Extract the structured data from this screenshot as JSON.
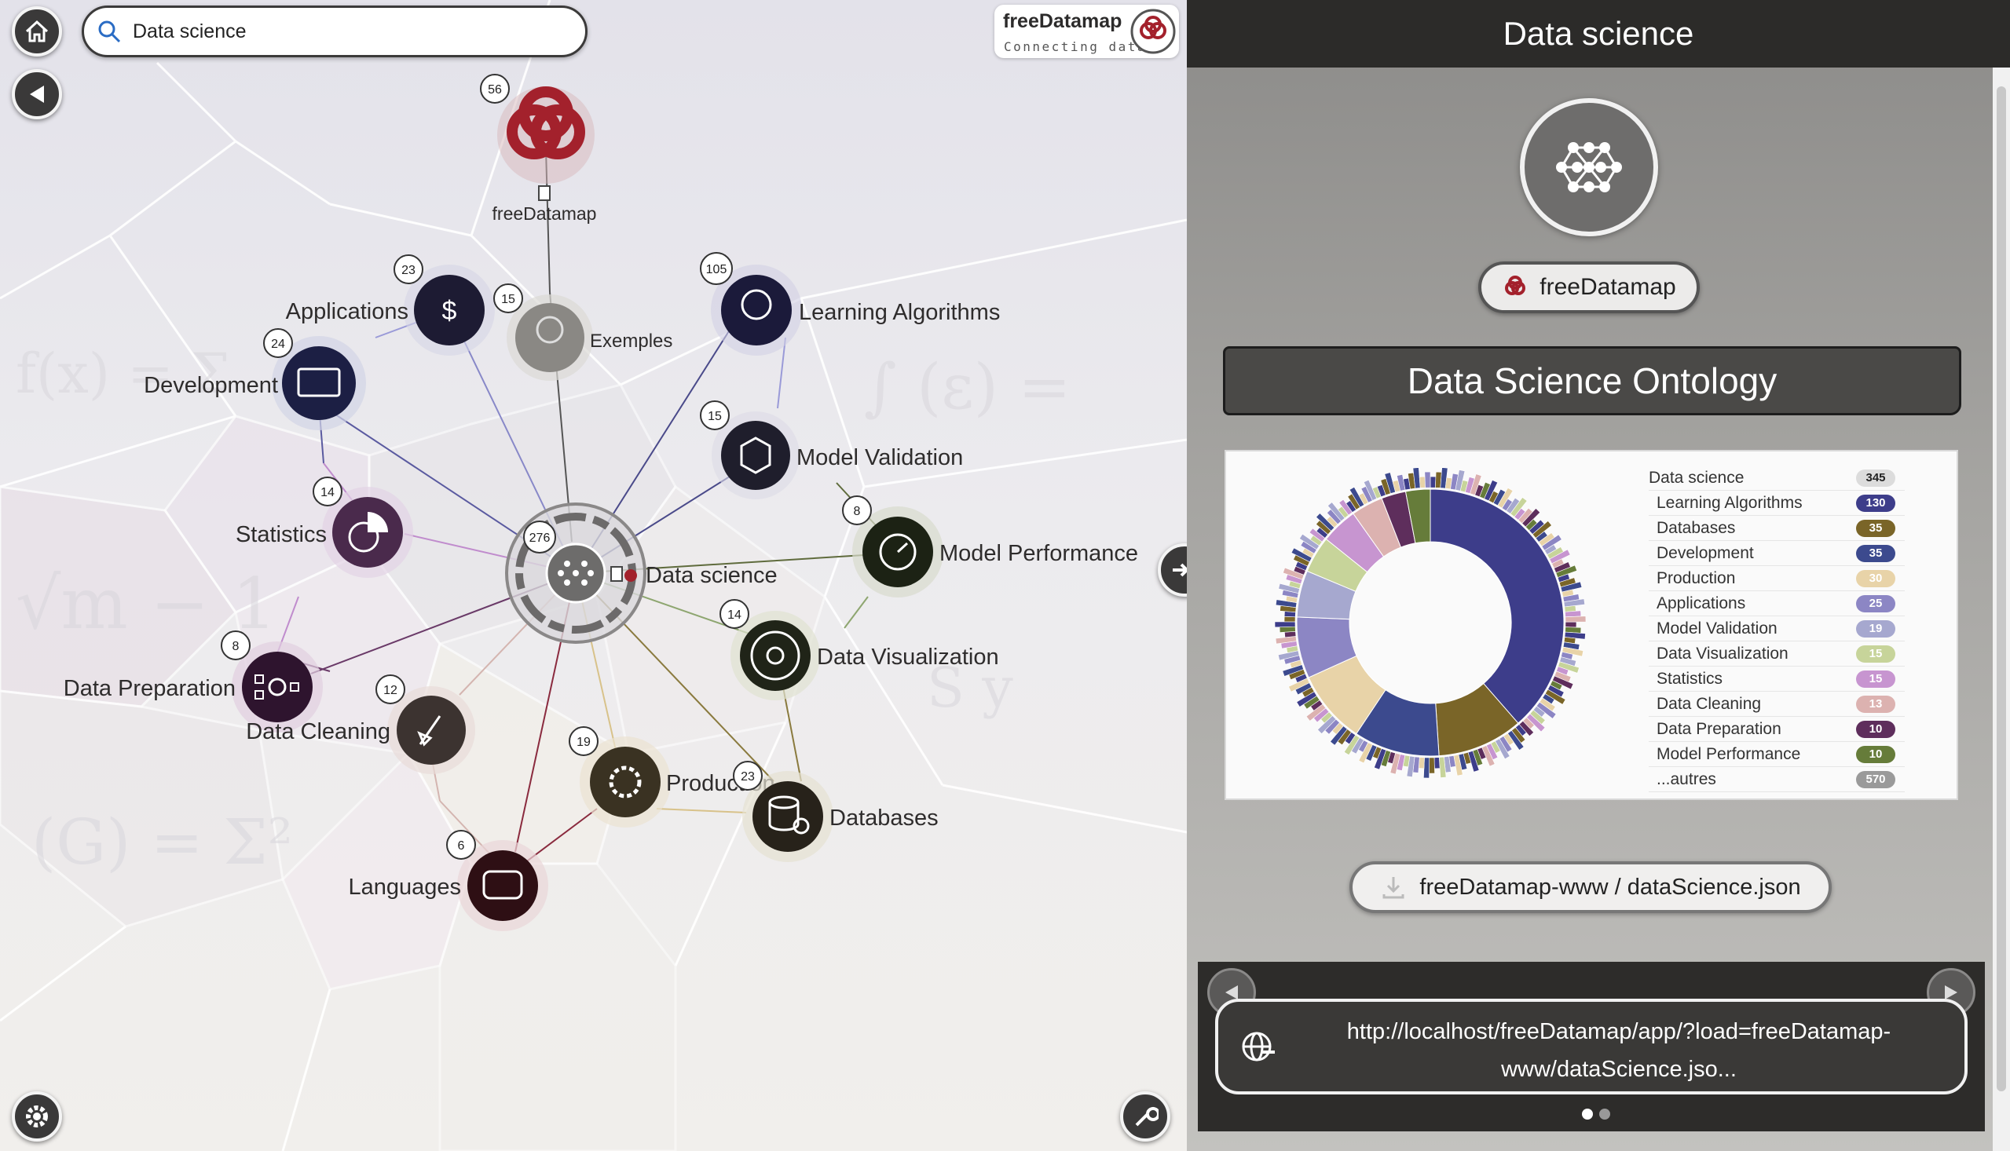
{
  "search": {
    "value": "Data science"
  },
  "logo": {
    "title": "freeDatamap",
    "subtitle": "Connecting data"
  },
  "map": {
    "nodes": [
      {
        "id": "freedatamap",
        "label": "freeDatamap",
        "badge": "56"
      },
      {
        "id": "applications",
        "label": "Applications",
        "badge": "23"
      },
      {
        "id": "exemples",
        "label": "Exemples",
        "badge": "15"
      },
      {
        "id": "learning-algorithms",
        "label": "Learning Algorithms",
        "badge": "105"
      },
      {
        "id": "development",
        "label": "Development",
        "badge": "24"
      },
      {
        "id": "model-validation",
        "label": "Model Validation",
        "badge": "15"
      },
      {
        "id": "statistics",
        "label": "Statistics",
        "badge": "14"
      },
      {
        "id": "data-science",
        "label": "Data science",
        "badge": "276"
      },
      {
        "id": "model-performance",
        "label": "Model Performance",
        "badge": "8"
      },
      {
        "id": "data-visualization",
        "label": "Data Visualization",
        "badge": "14"
      },
      {
        "id": "data-preparation",
        "label": "Data Preparation",
        "badge": "8"
      },
      {
        "id": "data-cleaning",
        "label": "Data Cleaning",
        "badge": "12"
      },
      {
        "id": "production",
        "label": "Production",
        "badge": "19"
      },
      {
        "id": "databases",
        "label": "Databases",
        "badge": "23"
      },
      {
        "id": "languages",
        "label": "Languages",
        "badge": "6"
      }
    ]
  },
  "panel": {
    "title": "Data science",
    "source_label": "freeDatamap",
    "ontology_title": "Data Science Ontology",
    "legend": [
      {
        "name": "Data science",
        "count": "345",
        "color": "#dcdcdc",
        "text_color": "#222"
      },
      {
        "name": "Learning Algorithms",
        "count": "130",
        "color": "#3d3d8a"
      },
      {
        "name": "Databases",
        "count": "35",
        "color": "#7a6528"
      },
      {
        "name": "Development",
        "count": "35",
        "color": "#3c4a8e"
      },
      {
        "name": "Production",
        "count": "30",
        "color": "#e8d3a8"
      },
      {
        "name": "Applications",
        "count": "25",
        "color": "#8c86c4"
      },
      {
        "name": "Model Validation",
        "count": "19",
        "color": "#a6a8cf"
      },
      {
        "name": "Data Visualization",
        "count": "15",
        "color": "#c7d49a"
      },
      {
        "name": "Statistics",
        "count": "15",
        "color": "#c795d0"
      },
      {
        "name": "Data Cleaning",
        "count": "13",
        "color": "#dcb2b0"
      },
      {
        "name": "Data Preparation",
        "count": "10",
        "color": "#5e2e5c"
      },
      {
        "name": "Model Performance",
        "count": "10",
        "color": "#667c3a"
      },
      {
        "name": "...autres",
        "count": "570",
        "color": "#9a9a9a"
      }
    ],
    "file_label": "freeDatamap-www / dataScience.json",
    "url_text": "http://localhost/freeDatamap/app/?load=freeDatamap-www/dataScience.jso..."
  }
}
